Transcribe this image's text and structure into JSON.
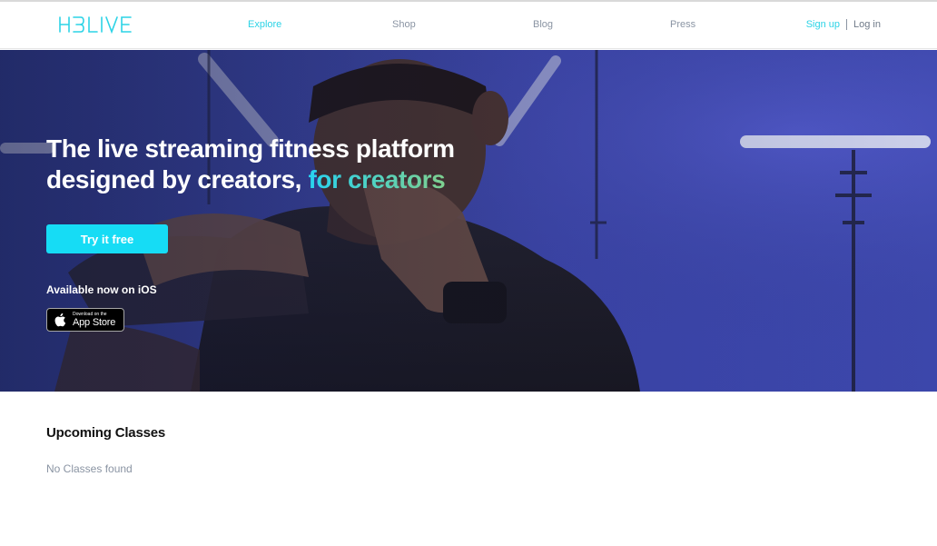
{
  "brand": {
    "logo_text": "HBLIVE"
  },
  "nav": {
    "items": [
      {
        "label": "Explore",
        "active": true
      },
      {
        "label": "Shop",
        "active": false
      },
      {
        "label": "Blog",
        "active": false
      },
      {
        "label": "Press",
        "active": false
      }
    ],
    "signup": "Sign up",
    "login": "Log in"
  },
  "hero": {
    "headline_part1": "The live streaming fitness platform",
    "headline_part2": "designed by creators,",
    "headline_accent": "for creators",
    "cta_label": "Try it free",
    "ios_label": "Available now on iOS",
    "appstore_small": "Download on the",
    "appstore_big": "App Store"
  },
  "upcoming": {
    "title": "Upcoming Classes",
    "empty": "No Classes found"
  },
  "colors": {
    "accent": "#16dcf5",
    "nav_active": "#2cd3e6",
    "hero_bg": "#3c47a6",
    "accent_gradient_end": "#7ed08f"
  }
}
